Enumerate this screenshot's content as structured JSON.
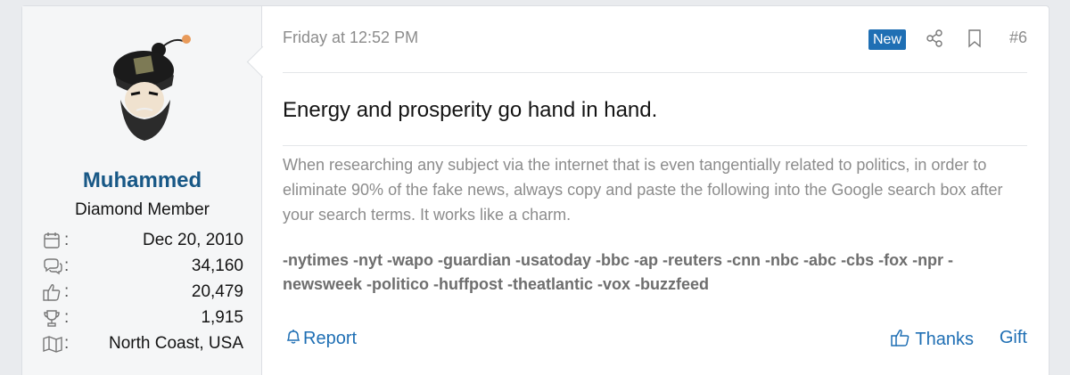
{
  "user": {
    "name": "Muhammed",
    "title": "Diamond Member",
    "stats": [
      {
        "icon": "calendar-icon",
        "value": "Dec 20, 2010"
      },
      {
        "icon": "messages-icon",
        "value": "34,160"
      },
      {
        "icon": "thumbs-up-icon",
        "value": "20,479"
      },
      {
        "icon": "trophy-icon",
        "value": "1,915"
      },
      {
        "icon": "map-icon",
        "value": "North Coast, USA"
      }
    ],
    "stat_colon": ":"
  },
  "post": {
    "date": "Friday at 12:52 PM",
    "badge": "New",
    "number": "#6",
    "headline": "Energy and prosperity go hand in hand.",
    "signature": "When researching any subject via the internet that is even tangentially related to politics, in order to eliminate 90% of the fake news, always copy and paste the following into the Google search box after your search terms. It works like a charm.",
    "search_terms": "-nytimes -nyt -wapo -guardian -usatoday -bbc -ap -reuters -cnn -nbc -abc -cbs -fox -npr -newsweek -politico -huffpost -theatlantic -vox -buzzfeed"
  },
  "actions": {
    "report": "Report",
    "thanks": "Thanks",
    "gift": "Gift"
  },
  "colors": {
    "link": "#1f6fb4",
    "username": "#185886",
    "badge_bg": "#1f6fb4",
    "muted": "#8c8c8c"
  }
}
